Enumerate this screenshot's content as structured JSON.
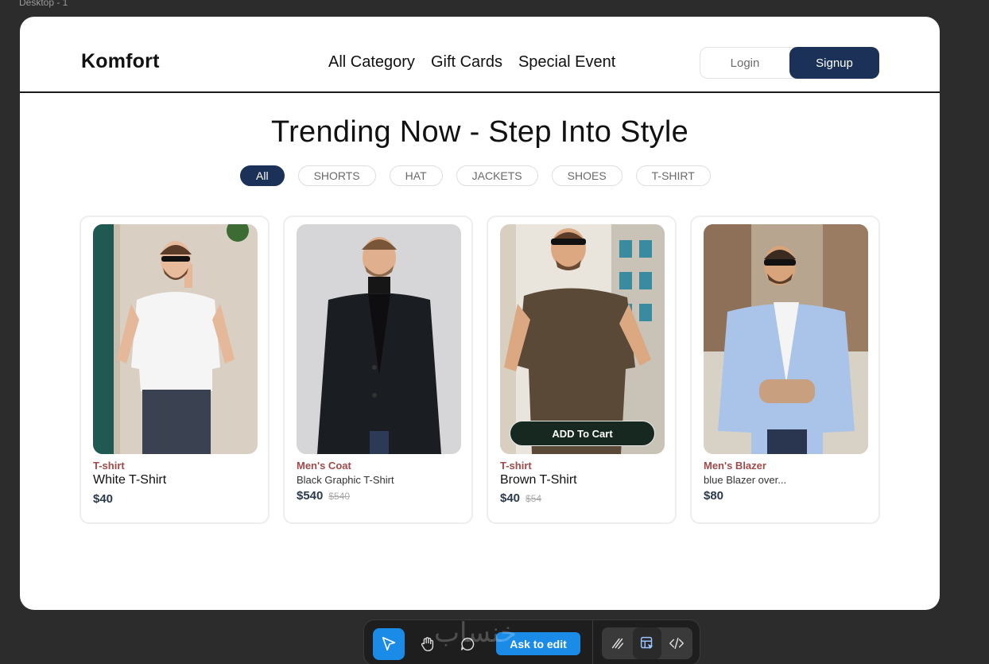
{
  "canvas": {
    "frame_label": "Desktop - 1"
  },
  "header": {
    "brand": "Komfort",
    "nav": [
      "All Category",
      "Gift Cards",
      "Special Event"
    ],
    "login_label": "Login",
    "signup_label": "Signup"
  },
  "hero": {
    "title": "Trending Now - Step Into Style",
    "filters": [
      "All",
      "SHORTS",
      "HAT",
      "JACKETS",
      "SHOES",
      "T-SHIRT"
    ],
    "active_filter": "All"
  },
  "products": [
    {
      "category": "T-shirt",
      "name": "White T-Shirt",
      "price": "$40",
      "old_price": ""
    },
    {
      "category": "Men's Coat",
      "name": "Black Graphic T-Shirt",
      "price": "$540",
      "old_price": "$540"
    },
    {
      "category": "T-shirt",
      "name": "Brown T-Shirt",
      "price": "$40",
      "old_price": "$54",
      "cart_label": "ADD To Cart"
    },
    {
      "category": "Men's Blazer",
      "name": "blue Blazer over...",
      "price": "$80",
      "old_price": ""
    }
  ],
  "toolbar": {
    "ask_label": "Ask to edit",
    "watermark": "خنساب"
  },
  "colors": {
    "accent": "#1b3157",
    "category_text": "#a14a4a",
    "price_text": "#2b3a4d",
    "cart_button": "#16281f",
    "tool_active": "#1a8ce8",
    "canvas_bg": "#2c2c2c"
  }
}
